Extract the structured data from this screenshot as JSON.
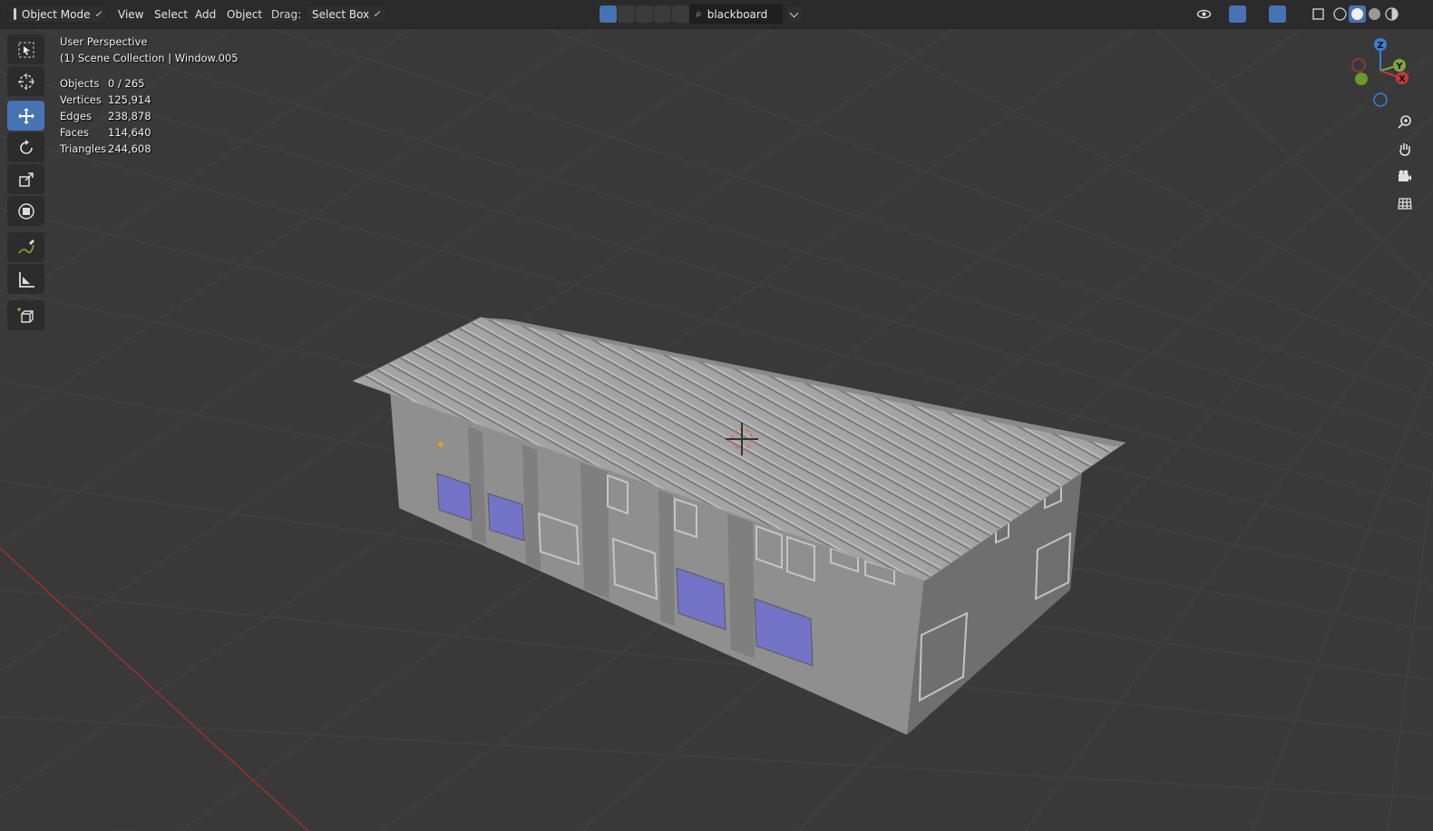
{
  "header": {
    "mode_label": "Object Mode",
    "menus": [
      "View",
      "Select",
      "Add",
      "Object"
    ],
    "drag_label": "Drag:",
    "drag_value": "Select Box",
    "search_value": "blackboard"
  },
  "overlay": {
    "view_name": "User Perspective",
    "collection": "(1) Scene Collection | Window.005",
    "stats": [
      {
        "label": "Objects",
        "value": "0 / 265"
      },
      {
        "label": "Vertices",
        "value": "125,914"
      },
      {
        "label": "Edges",
        "value": "238,878"
      },
      {
        "label": "Faces",
        "value": "114,640"
      },
      {
        "label": "Triangles",
        "value": "244,608"
      }
    ]
  },
  "gizmo": {
    "z": "Z",
    "y": "Y",
    "x": "X"
  },
  "toolbar": [
    "select-box-tool",
    "cursor-tool",
    "move-tool",
    "rotate-tool",
    "scale-tool",
    "transform-tool",
    "annotate-tool",
    "measure-tool",
    "add-cube-tool"
  ],
  "colors": {
    "accent": "#4772b3",
    "background": "#393939",
    "header": "#2b2b2b",
    "x_axis": "#c23b3b",
    "y_axis": "#7fa83a",
    "z_axis": "#3a7fd3",
    "window_glass": "#7373c7"
  }
}
